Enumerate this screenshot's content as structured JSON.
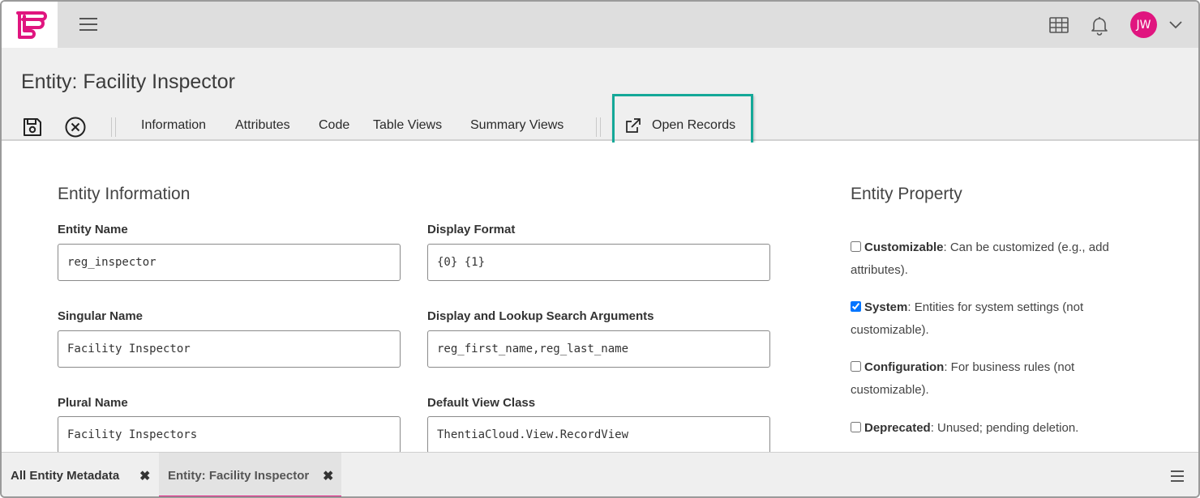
{
  "app": {
    "brand_color": "#e0157f",
    "accent_highlight": "#14a898",
    "logo_icon": "app-logo",
    "menu_icon": "hamburger-menu-icon"
  },
  "topbar": {
    "icons": [
      "grid-icon",
      "bell-icon"
    ],
    "user_initials": "JW",
    "user_menu_icon": "chevron-down-icon"
  },
  "header": {
    "title": "Entity: Facility Inspector",
    "toolbar": {
      "save_icon": "save-icon",
      "close_icon": "close-circle-icon",
      "tabs": [
        {
          "label": "Information"
        },
        {
          "label": "Attributes"
        },
        {
          "label": "Code"
        },
        {
          "label": "Table Views"
        },
        {
          "label": "Summary Views"
        }
      ],
      "open_records_label": "Open Records",
      "open_records_icon": "external-link-icon"
    }
  },
  "entity_information": {
    "title": "Entity Information",
    "fields": [
      {
        "label": "Entity Name",
        "value": "reg_inspector"
      },
      {
        "label": "Display Format",
        "value": "{0} {1}"
      },
      {
        "label": "Singular Name",
        "value": "Facility Inspector"
      },
      {
        "label": "Display and Lookup Search Arguments",
        "value": "reg_first_name,reg_last_name"
      },
      {
        "label": "Plural Name",
        "value": "Facility Inspectors"
      },
      {
        "label": "Default View Class",
        "value": "ThentiaCloud.View.RecordView"
      }
    ]
  },
  "entity_property": {
    "title": "Entity Property",
    "items": [
      {
        "name": "Customizable",
        "desc": ": Can be customized (e.g., add attributes).",
        "checked": false
      },
      {
        "name": "System",
        "desc": ": Entities for system settings (not customizable).",
        "checked": true
      },
      {
        "name": "Configuration",
        "desc": ": For business rules (not customizable).",
        "checked": false
      },
      {
        "name": "Deprecated",
        "desc": ": Unused; pending deletion.",
        "checked": false
      }
    ]
  },
  "bottom_tabs": {
    "tabs": [
      {
        "label": "All Entity Metadata",
        "close": "✖",
        "active": false
      },
      {
        "label": "Entity: Facility Inspector",
        "close": "✖",
        "active": true
      }
    ],
    "menu_icon": "list-menu-icon"
  }
}
